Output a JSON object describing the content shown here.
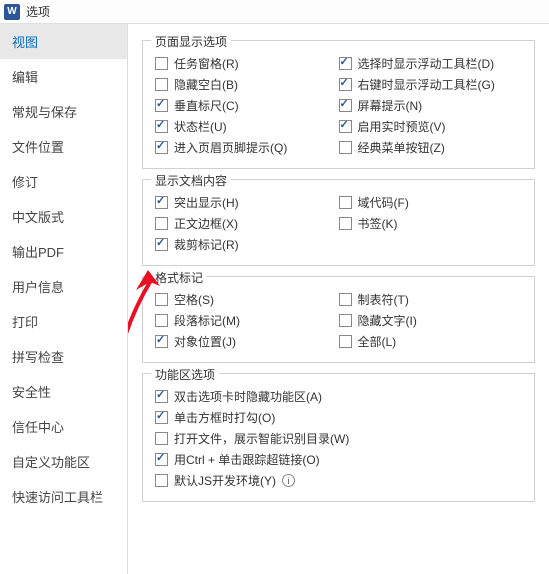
{
  "title": "选项",
  "logo": "W",
  "sidebar": {
    "items": [
      {
        "label": "视图",
        "active": true
      },
      {
        "label": "编辑"
      },
      {
        "label": "常规与保存"
      },
      {
        "label": "文件位置"
      },
      {
        "label": "修订"
      },
      {
        "label": "中文版式"
      },
      {
        "label": "输出PDF"
      },
      {
        "label": "用户信息"
      },
      {
        "label": "打印"
      },
      {
        "label": "拼写检查"
      },
      {
        "label": "安全性"
      },
      {
        "label": "信任中心"
      },
      {
        "label": "自定义功能区"
      },
      {
        "label": "快速访问工具栏"
      }
    ]
  },
  "groups": {
    "display": {
      "title": "页面显示选项",
      "left": [
        {
          "label": "任务窗格(R)",
          "checked": false
        },
        {
          "label": "隐藏空白(B)",
          "checked": false
        },
        {
          "label": "垂直标尺(C)",
          "checked": true
        },
        {
          "label": "状态栏(U)",
          "checked": true
        },
        {
          "label": "进入页眉页脚提示(Q)",
          "checked": true
        }
      ],
      "right": [
        {
          "label": "选择时显示浮动工具栏(D)",
          "checked": true
        },
        {
          "label": "右键时显示浮动工具栏(G)",
          "checked": true
        },
        {
          "label": "屏幕提示(N)",
          "checked": true
        },
        {
          "label": "启用实时预览(V)",
          "checked": true
        },
        {
          "label": "经典菜单按钮(Z)",
          "checked": false
        }
      ]
    },
    "docContent": {
      "title": "显示文档内容",
      "left": [
        {
          "label": "突出显示(H)",
          "checked": true
        },
        {
          "label": "正文边框(X)",
          "checked": false
        },
        {
          "label": "裁剪标记(R)",
          "checked": true
        }
      ],
      "right": [
        {
          "label": "域代码(F)",
          "checked": false
        },
        {
          "label": "书签(K)",
          "checked": false
        }
      ]
    },
    "formatMarks": {
      "title": "格式标记",
      "left": [
        {
          "label": "空格(S)",
          "checked": false
        },
        {
          "label": "段落标记(M)",
          "checked": false
        },
        {
          "label": "对象位置(J)",
          "checked": true
        }
      ],
      "right": [
        {
          "label": "制表符(T)",
          "checked": false
        },
        {
          "label": "隐藏文字(I)",
          "checked": false
        },
        {
          "label": "全部(L)",
          "checked": false
        }
      ]
    },
    "ribbon": {
      "title": "功能区选项",
      "items": [
        {
          "label": "双击选项卡时隐藏功能区(A)",
          "checked": true
        },
        {
          "label": "单击方框时打勾(O)",
          "checked": true
        },
        {
          "label": "打开文件，展示智能识别目录(W)",
          "checked": false
        },
        {
          "label": "用Ctrl + 单击跟踪超链接(O)",
          "checked": true
        },
        {
          "label": "默认JS开发环境(Y)",
          "checked": false,
          "info": true
        }
      ]
    }
  }
}
